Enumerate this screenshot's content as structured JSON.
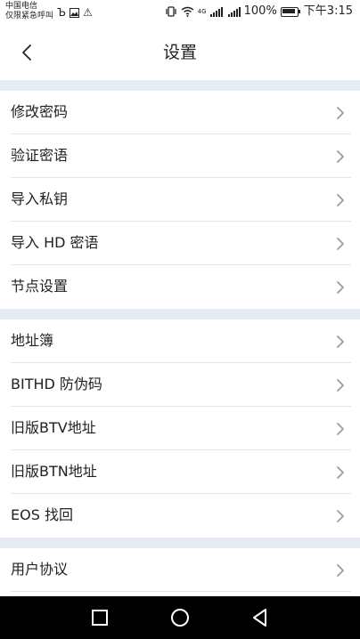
{
  "status_bar": {
    "carrier_line1": "中国电信",
    "carrier_line2": "仅限紧急呼叫",
    "left_glyph_b": "Ъ",
    "left_glyph_warning": "⚠",
    "signal_label": "4G",
    "battery_percent": "100%",
    "time": "下午3:15"
  },
  "header": {
    "title": "设置"
  },
  "groups": [
    {
      "items": [
        {
          "label": "修改密码"
        },
        {
          "label": "验证密语"
        },
        {
          "label": "导入私钥"
        },
        {
          "label": "导入 HD 密语"
        },
        {
          "label": "节点设置"
        }
      ]
    },
    {
      "items": [
        {
          "label": "地址簿"
        },
        {
          "label": "BITHD 防伪码"
        },
        {
          "label": "旧版BTV地址"
        },
        {
          "label": "旧版BTN地址"
        },
        {
          "label": "EOS 找回"
        }
      ]
    },
    {
      "items": [
        {
          "label": "用户协议"
        }
      ]
    }
  ],
  "icons": {
    "back": "chevron-left-icon",
    "row_arrow": "chevron-right-icon",
    "nav_recent": "square-icon",
    "nav_home": "circle-icon",
    "nav_back": "triangle-back-icon"
  },
  "colors": {
    "section_gap": "#e7ebf3",
    "chevron": "#9a9da3",
    "nav_bar": "#000000"
  }
}
